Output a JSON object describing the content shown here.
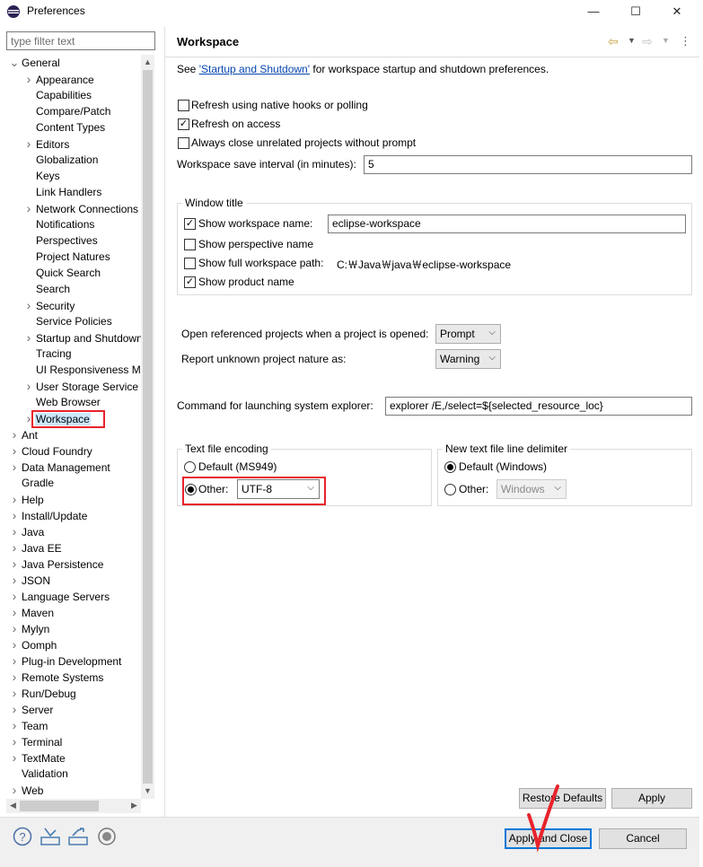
{
  "window": {
    "title": "Preferences",
    "minimize": "—",
    "maximize": "☐",
    "close": "✕"
  },
  "filter": {
    "placeholder": "type filter text"
  },
  "tree": {
    "items": [
      {
        "label": "General",
        "level": 0,
        "expanded": true,
        "hasChildren": true,
        "selected": false
      },
      {
        "label": "Appearance",
        "level": 1,
        "hasChildren": true
      },
      {
        "label": "Capabilities",
        "level": 1,
        "hasChildren": false
      },
      {
        "label": "Compare/Patch",
        "level": 1,
        "hasChildren": false
      },
      {
        "label": "Content Types",
        "level": 1,
        "hasChildren": false
      },
      {
        "label": "Editors",
        "level": 1,
        "hasChildren": true
      },
      {
        "label": "Globalization",
        "level": 1,
        "hasChildren": false
      },
      {
        "label": "Keys",
        "level": 1,
        "hasChildren": false
      },
      {
        "label": "Link Handlers",
        "level": 1,
        "hasChildren": false
      },
      {
        "label": "Network Connections",
        "level": 1,
        "hasChildren": true
      },
      {
        "label": "Notifications",
        "level": 1,
        "hasChildren": false
      },
      {
        "label": "Perspectives",
        "level": 1,
        "hasChildren": false
      },
      {
        "label": "Project Natures",
        "level": 1,
        "hasChildren": false
      },
      {
        "label": "Quick Search",
        "level": 1,
        "hasChildren": false
      },
      {
        "label": "Search",
        "level": 1,
        "hasChildren": false
      },
      {
        "label": "Security",
        "level": 1,
        "hasChildren": true
      },
      {
        "label": "Service Policies",
        "level": 1,
        "hasChildren": false
      },
      {
        "label": "Startup and Shutdown",
        "level": 1,
        "hasChildren": true
      },
      {
        "label": "Tracing",
        "level": 1,
        "hasChildren": false
      },
      {
        "label": "UI Responsiveness Monitoring",
        "level": 1,
        "hasChildren": false
      },
      {
        "label": "User Storage Service",
        "level": 1,
        "hasChildren": true
      },
      {
        "label": "Web Browser",
        "level": 1,
        "hasChildren": false
      },
      {
        "label": "Workspace",
        "level": 1,
        "hasChildren": true,
        "selected": true
      },
      {
        "label": "Ant",
        "level": 0,
        "hasChildren": true
      },
      {
        "label": "Cloud Foundry",
        "level": 0,
        "hasChildren": true
      },
      {
        "label": "Data Management",
        "level": 0,
        "hasChildren": true
      },
      {
        "label": "Gradle",
        "level": 0,
        "hasChildren": false
      },
      {
        "label": "Help",
        "level": 0,
        "hasChildren": true
      },
      {
        "label": "Install/Update",
        "level": 0,
        "hasChildren": true
      },
      {
        "label": "Java",
        "level": 0,
        "hasChildren": true
      },
      {
        "label": "Java EE",
        "level": 0,
        "hasChildren": true
      },
      {
        "label": "Java Persistence",
        "level": 0,
        "hasChildren": true
      },
      {
        "label": "JSON",
        "level": 0,
        "hasChildren": true
      },
      {
        "label": "Language Servers",
        "level": 0,
        "hasChildren": true
      },
      {
        "label": "Maven",
        "level": 0,
        "hasChildren": true
      },
      {
        "label": "Mylyn",
        "level": 0,
        "hasChildren": true
      },
      {
        "label": "Oomph",
        "level": 0,
        "hasChildren": true
      },
      {
        "label": "Plug-in Development",
        "level": 0,
        "hasChildren": true
      },
      {
        "label": "Remote Systems",
        "level": 0,
        "hasChildren": true
      },
      {
        "label": "Run/Debug",
        "level": 0,
        "hasChildren": true
      },
      {
        "label": "Server",
        "level": 0,
        "hasChildren": true
      },
      {
        "label": "Team",
        "level": 0,
        "hasChildren": true
      },
      {
        "label": "Terminal",
        "level": 0,
        "hasChildren": true
      },
      {
        "label": "TextMate",
        "level": 0,
        "hasChildren": true
      },
      {
        "label": "Validation",
        "level": 0,
        "hasChildren": false
      },
      {
        "label": "Web",
        "level": 0,
        "hasChildren": true
      }
    ]
  },
  "page": {
    "title": "Workspace",
    "intro_prefix": "See ",
    "intro_link": "'Startup and Shutdown'",
    "intro_suffix": " for workspace startup and shutdown preferences.",
    "refresh_native": {
      "label": "Refresh using native hooks or polling",
      "checked": false
    },
    "refresh_access": {
      "label": "Refresh on access",
      "checked": true
    },
    "always_close": {
      "label": "Always close unrelated projects without prompt",
      "checked": false
    },
    "save_interval_label": "Workspace save interval (in minutes):",
    "save_interval_value": "5",
    "window_title": {
      "group_label": "Window title",
      "show_name": {
        "label": "Show workspace name:",
        "checked": true,
        "value": "eclipse-workspace"
      },
      "show_perspective": {
        "label": "Show perspective name",
        "checked": false
      },
      "show_path": {
        "label": "Show full workspace path:",
        "checked": false,
        "value": "C:￦Java￦java￦eclipse-workspace"
      },
      "show_product": {
        "label": "Show product name",
        "checked": true
      }
    },
    "open_referenced_label": "Open referenced projects when a project is opened:",
    "open_referenced_value": "Prompt",
    "unknown_nature_label": "Report unknown project nature as:",
    "unknown_nature_value": "Warning",
    "explorer_label": "Command for launching system explorer:",
    "explorer_value": "explorer /E,/select=${selected_resource_loc}",
    "encoding": {
      "group_label": "Text file encoding",
      "default_label": "Default (MS949)",
      "other_label": "Other:",
      "other_value": "UTF-8",
      "selected": "other"
    },
    "line_delimiter": {
      "group_label": "New text file line delimiter",
      "default_label": "Default (Windows)",
      "other_label": "Other:",
      "other_value": "Windows",
      "selected": "default"
    },
    "restore_defaults": "Restore Defaults",
    "apply": "Apply"
  },
  "footer": {
    "apply_close": "Apply and Close",
    "cancel": "Cancel",
    "icons": [
      "help-icon",
      "import-icon",
      "export-icon",
      "oomph-record-icon"
    ]
  },
  "colors": {
    "highlight": "#e8232b",
    "link": "#0645ad",
    "selection": "#cce8ff"
  }
}
